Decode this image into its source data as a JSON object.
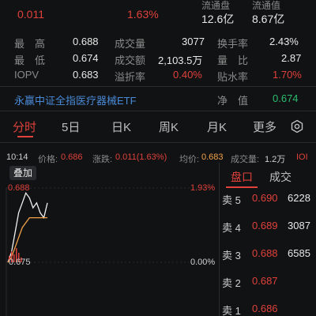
{
  "top_row": {
    "price_partial": "0.011",
    "change_pct": "1.63%",
    "float_shares_value": "12.6亿",
    "float_mktcap_value": "8.67亿",
    "float_shares_label": "流通盘",
    "float_mktcap_label": "流通值"
  },
  "stats": [
    {
      "label": "最　高",
      "value": "0.688",
      "label2": "成交量",
      "value2": "3077",
      "label3": "换手率",
      "value3": "2.43%"
    },
    {
      "label": "最　低",
      "value": "0.674",
      "label2": "成交额",
      "value2": "2,103.5万",
      "label3": "量　比",
      "value3": "2.87"
    },
    {
      "label": "IOPV",
      "value": "0.683",
      "label2": "溢折率",
      "value2": "0.40%",
      "label3": "贴水率",
      "value3": "1.70%"
    }
  ],
  "fund": {
    "name": "永赢中证全指医疗器械ETF",
    "nav_label": "净　值",
    "nav_value": "0.674"
  },
  "tabs": [
    "分时",
    "5日",
    "日K",
    "周K",
    "月K",
    "更多"
  ],
  "settings_icon": "gear-icon",
  "info_bar": {
    "time": "10:14",
    "price_label": "价格:",
    "price": "0.686",
    "change_label": "涨跌:",
    "change": "0.011(1.63%)",
    "avg_label": "均价:",
    "avg": "0.683",
    "vol_label": "成交量:",
    "vol": "1.2万",
    "iopv_badge": "IOI"
  },
  "chart": {
    "overlay_button": "叠加",
    "high_label": "0.688",
    "low_label": "0.675",
    "high_pct": "1.93%",
    "zero_pct": "0.00%"
  },
  "chart_data": {
    "type": "line",
    "series": [
      {
        "name": "price",
        "values": [
          0.674,
          0.676,
          0.68,
          0.684,
          0.686,
          0.688,
          0.687,
          0.685,
          0.686,
          0.684,
          0.683,
          0.686
        ]
      },
      {
        "name": "avg",
        "values": [
          0.674,
          0.675,
          0.677,
          0.679,
          0.681,
          0.682,
          0.683,
          0.683,
          0.683,
          0.683,
          0.683,
          0.683
        ]
      }
    ],
    "ylim": [
      0.674,
      0.689
    ]
  },
  "order_book": {
    "tab_active": "盘口",
    "tab_other": "成交",
    "rows": [
      {
        "label": "卖 5",
        "price": "0.690",
        "volume": "6228"
      },
      {
        "label": "卖 4",
        "price": "0.689",
        "volume": "3087"
      },
      {
        "label": "卖 3",
        "price": "0.688",
        "volume": "6585"
      },
      {
        "label": "卖 2",
        "price": "0.687",
        "volume": ""
      },
      {
        "label": "卖 1",
        "price": "0.686",
        "volume": ""
      }
    ]
  },
  "colors": {
    "up": "#e0413b",
    "down": "#2dbd6e",
    "accent": "#f3a24a",
    "bg": "#111213"
  }
}
